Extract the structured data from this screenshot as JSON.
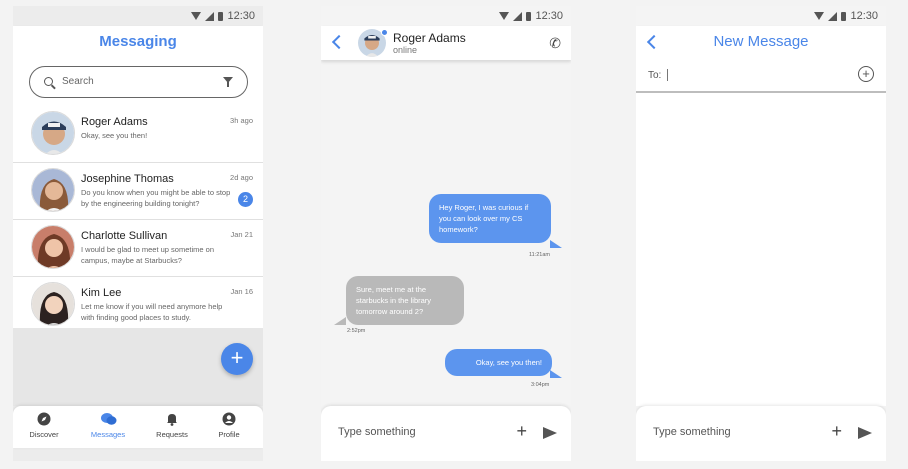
{
  "status_bar": {
    "time": "12:30"
  },
  "messaging": {
    "title": "Messaging",
    "search_placeholder": "Search",
    "conversations": [
      {
        "name": "Roger Adams",
        "preview": "Okay, see you then!",
        "time": "3h ago",
        "badge": ""
      },
      {
        "name": "Josephine Thomas",
        "preview": "Do you know when you might be able to stop by the engineering building tonight?",
        "time": "2d ago",
        "badge": "2"
      },
      {
        "name": "Charlotte Sullivan",
        "preview": "I would be glad to meet up sometime on campus, maybe at Starbucks?",
        "time": "Jan 21",
        "badge": ""
      },
      {
        "name": "Kim Lee",
        "preview": "Let me know if you will need anymore help with finding good places to study.",
        "time": "Jan 16",
        "badge": ""
      }
    ],
    "fab_label": "+",
    "nav": [
      {
        "label": "Discover",
        "icon": "compass-icon"
      },
      {
        "label": "Messages",
        "icon": "chat-bubbles-icon"
      },
      {
        "label": "Requests",
        "icon": "bell-icon"
      },
      {
        "label": "Profile",
        "icon": "user-icon"
      }
    ],
    "active_nav": "Messages"
  },
  "chat": {
    "contact_name": "Roger Adams",
    "contact_status": "online",
    "messages": [
      {
        "direction": "out",
        "text": "Hey Roger, I was curious if you can look over my CS homework?",
        "time": "11:21am"
      },
      {
        "direction": "in",
        "text": "Sure, meet me at the starbucks in the library tomorrow around 2?",
        "time": "2:52pm"
      },
      {
        "direction": "out",
        "text": "Okay, see you then!",
        "time": "3:04pm"
      }
    ],
    "composer_placeholder": "Type something"
  },
  "new_message": {
    "title": "New Message",
    "to_label": "To:",
    "composer_placeholder": "Type something"
  },
  "colors": {
    "accent": "#4a86e8",
    "outgoing_bubble": "#5c95ee",
    "incoming_bubble": "#b9b9b9"
  }
}
